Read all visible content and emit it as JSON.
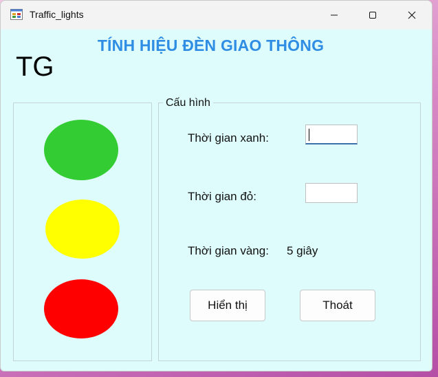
{
  "window": {
    "title": "Traffic_lights"
  },
  "header": {
    "title": "TÍNH HIỆU ĐÈN GIAO THÔNG",
    "time_display": "TG"
  },
  "lights": [
    {
      "name": "green",
      "color": "#33cc33"
    },
    {
      "name": "yellow",
      "color": "#ffff00"
    },
    {
      "name": "red",
      "color": "#ff0000"
    }
  ],
  "config": {
    "legend": "Cấu hình",
    "green_label": "Thời gian xanh:",
    "green_value": "",
    "red_label": "Thời gian đỏ:",
    "red_value": "",
    "yellow_label": "Thời gian vàng:",
    "yellow_value": "5 giây"
  },
  "buttons": {
    "show": "Hiển thị",
    "exit": "Thoát"
  },
  "colors": {
    "title_accent": "#2f8de4",
    "form_background": "#ddfcfb"
  }
}
